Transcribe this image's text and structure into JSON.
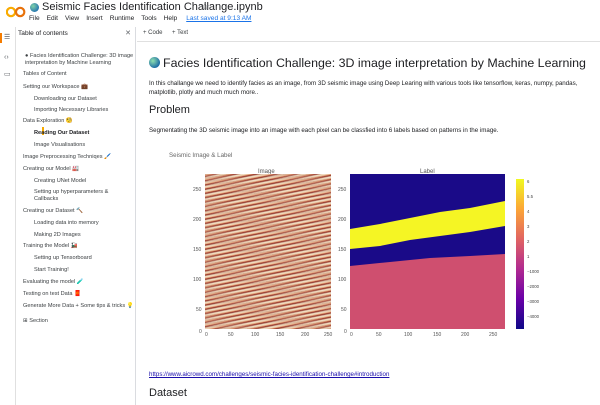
{
  "header": {
    "notebook_title": "Seismic Facies Identification Challange.ipynb",
    "menus": [
      "File",
      "Edit",
      "View",
      "Insert",
      "Runtime",
      "Tools",
      "Help"
    ],
    "saved_text": "Last saved at 9:13 AM"
  },
  "cellbar": {
    "code_label": "+ Code",
    "text_label": "+ Text"
  },
  "toc": {
    "title": "Table of contents",
    "items": [
      {
        "label": "Facies Identification Challenge: 3D image",
        "level": 1
      },
      {
        "label": "interpretation by Machine Learning",
        "level": 1
      },
      {
        "label": "Tables of Content",
        "level": 1
      },
      {
        "label": "Setting our Workspace 💼",
        "level": 1
      },
      {
        "label": "Downloading our Dataset",
        "level": 2
      },
      {
        "label": "Importing Necessary Libraries",
        "level": 2
      },
      {
        "label": "Data Exploration 🧐",
        "level": 1
      },
      {
        "label": "Reading Our Dataset",
        "level": 2,
        "active": true
      },
      {
        "label": "Image Visualisations",
        "level": 2
      },
      {
        "label": "Image Preprocessing Techniqes 🖌️",
        "level": 1
      },
      {
        "label": "Creating our Model 🏭",
        "level": 1
      },
      {
        "label": "Creating UNet Model",
        "level": 2
      },
      {
        "label": "Setting up hyperparameters &",
        "level": 2
      },
      {
        "label": "Callbacks",
        "level": 2
      },
      {
        "label": "Creating our Dataset 🔨",
        "level": 1
      },
      {
        "label": "Loading data into memory",
        "level": 2
      },
      {
        "label": "Making 2D Images",
        "level": 2
      },
      {
        "label": "Training the Model 🚂",
        "level": 1
      },
      {
        "label": "Setting up Tensorboard",
        "level": 2
      },
      {
        "label": "Start Training!",
        "level": 2
      },
      {
        "label": "Evaluating the model 🧪",
        "level": 1
      },
      {
        "label": "Testing on test Data 🧧",
        "level": 1
      },
      {
        "label": "Generate More Data + Some tips & tricks 💡",
        "level": 1
      }
    ],
    "section_label": "Section"
  },
  "main": {
    "title": "Facies Identification Challenge: 3D image interpretation by Machine Learning",
    "intro": "In this challange we need to identify facies as an image, from 3D seismic image using Deep Learing with various tools like tensorflow, keras, numpy, pandas, matplotlib, plotly and much much more..",
    "problem_heading": "Problem",
    "problem_text": "Segmentating the 3D seismic image into an image with each pixel can be classfied into 6 labels based on patterns in the image.",
    "figure": {
      "title": "Seismic Image & Label",
      "left_panel_title": "Image",
      "right_panel_title": "Label",
      "y_ticks": [
        "250",
        "200",
        "150",
        "100",
        "50",
        "0"
      ],
      "x_ticks_left": [
        "0",
        "50",
        "100",
        "150",
        "200",
        "250"
      ],
      "x_ticks_right": [
        "0",
        "50",
        "100",
        "150",
        "200",
        "250"
      ],
      "colorbar_ticks": [
        "6",
        "5.5",
        "4",
        "3",
        "2",
        "1",
        "−1000",
        "−2000",
        "−3000",
        "−4000"
      ],
      "colors": {
        "yellow": "#f5f524",
        "navy": "#1a0a88",
        "pink": "#cf4f6f"
      }
    },
    "link": "https://www.aicrowd.com/challenges/seismic-facies-identification-challenge#introduction",
    "dataset_heading": "Dataset"
  }
}
